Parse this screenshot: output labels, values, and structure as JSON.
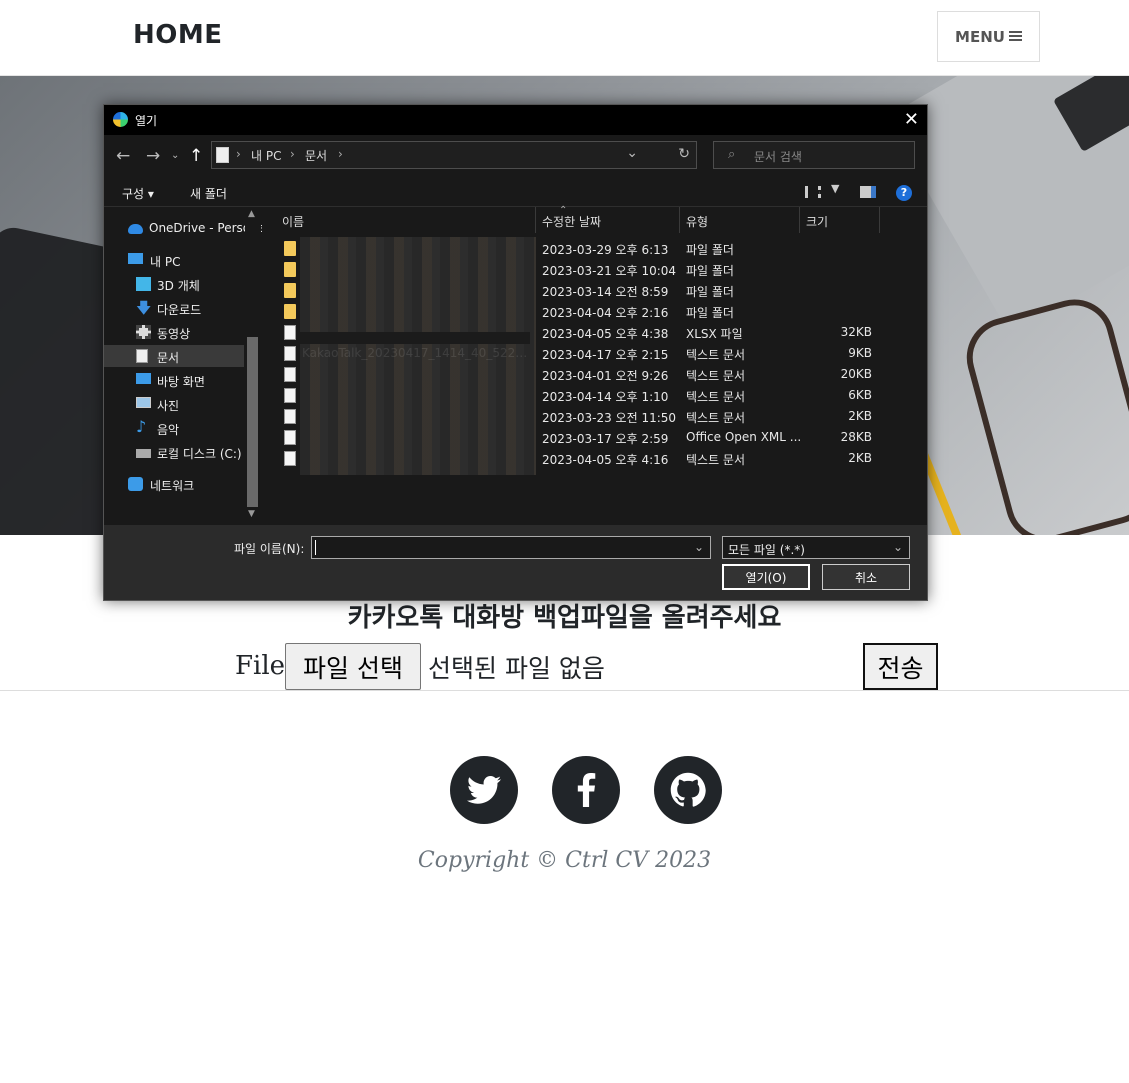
{
  "nav": {
    "brand": "HOME",
    "menu_label": "MENU"
  },
  "dialog": {
    "title": "열기",
    "breadcrumb": [
      "내 PC",
      "문서"
    ],
    "search_placeholder": "문서 검색",
    "toolbar": {
      "organize": "구성 ▾",
      "new_folder": "새 폴더"
    },
    "nav_items": [
      {
        "label": "OneDrive - Personal",
        "icon": "cloud-icon"
      },
      {
        "label": "내 PC",
        "icon": "computer-icon"
      },
      {
        "label": "3D 개체",
        "icon": "cube-icon"
      },
      {
        "label": "다운로드",
        "icon": "download-icon"
      },
      {
        "label": "동영상",
        "icon": "video-icon"
      },
      {
        "label": "문서",
        "icon": "document-icon",
        "selected": true
      },
      {
        "label": "바탕 화면",
        "icon": "desktop-icon"
      },
      {
        "label": "사진",
        "icon": "picture-icon"
      },
      {
        "label": "음악",
        "icon": "music-icon"
      },
      {
        "label": "로컬 디스크 (C:)",
        "icon": "disk-icon"
      },
      {
        "label": "네트워크",
        "icon": "network-icon"
      }
    ],
    "columns": [
      "이름",
      "수정한 날짜",
      "유형",
      "크기"
    ],
    "files": [
      {
        "name": "",
        "date": "2023-03-29 오후 6:13",
        "type": "파일 폴더",
        "size": "",
        "kind": "folder"
      },
      {
        "name": "",
        "date": "2023-03-21 오후 10:04",
        "type": "파일 폴더",
        "size": "",
        "kind": "folder"
      },
      {
        "name": "",
        "date": "2023-03-14 오전 8:59",
        "type": "파일 폴더",
        "size": "",
        "kind": "folder"
      },
      {
        "name": "",
        "date": "2023-04-04 오후 2:16",
        "type": "파일 폴더",
        "size": "",
        "kind": "folder"
      },
      {
        "name": "",
        "date": "2023-04-05 오후 4:38",
        "type": "XLSX 파일",
        "size": "32KB",
        "kind": "doc"
      },
      {
        "name": "KakaoTalk_20230417_1414_40_522_gro...",
        "date": "2023-04-17 오후 2:15",
        "type": "텍스트 문서",
        "size": "9KB",
        "kind": "doc"
      },
      {
        "name": "",
        "date": "2023-04-01 오전 9:26",
        "type": "텍스트 문서",
        "size": "20KB",
        "kind": "doc"
      },
      {
        "name": "",
        "date": "2023-04-14 오후 1:10",
        "type": "텍스트 문서",
        "size": "6KB",
        "kind": "doc"
      },
      {
        "name": "",
        "date": "2023-03-23 오전 11:50",
        "type": "텍스트 문서",
        "size": "2KB",
        "kind": "doc"
      },
      {
        "name": "",
        "date": "2023-03-17 오후 2:59",
        "type": "Office Open XML ...",
        "size": "28KB",
        "kind": "doc"
      },
      {
        "name": "",
        "date": "2023-04-05 오후 4:16",
        "type": "텍스트 문서",
        "size": "2KB",
        "kind": "doc"
      }
    ],
    "filename_label": "파일 이름(N):",
    "filename_value": "",
    "filetype_value": "모든 파일 (*.*)",
    "open_label": "열기(O)",
    "cancel_label": "취소"
  },
  "upload": {
    "title": "카카오톡 대화방 백업파일을 올려주세요",
    "file_label": "File:",
    "choose_label": "파일 선택",
    "no_file_text": "선택된 파일 없음",
    "submit_label": "전송"
  },
  "footer": {
    "social_icons": [
      "twitter-icon",
      "facebook-icon",
      "github-icon"
    ],
    "copyright": "Copyright © Ctrl CV 2023"
  }
}
